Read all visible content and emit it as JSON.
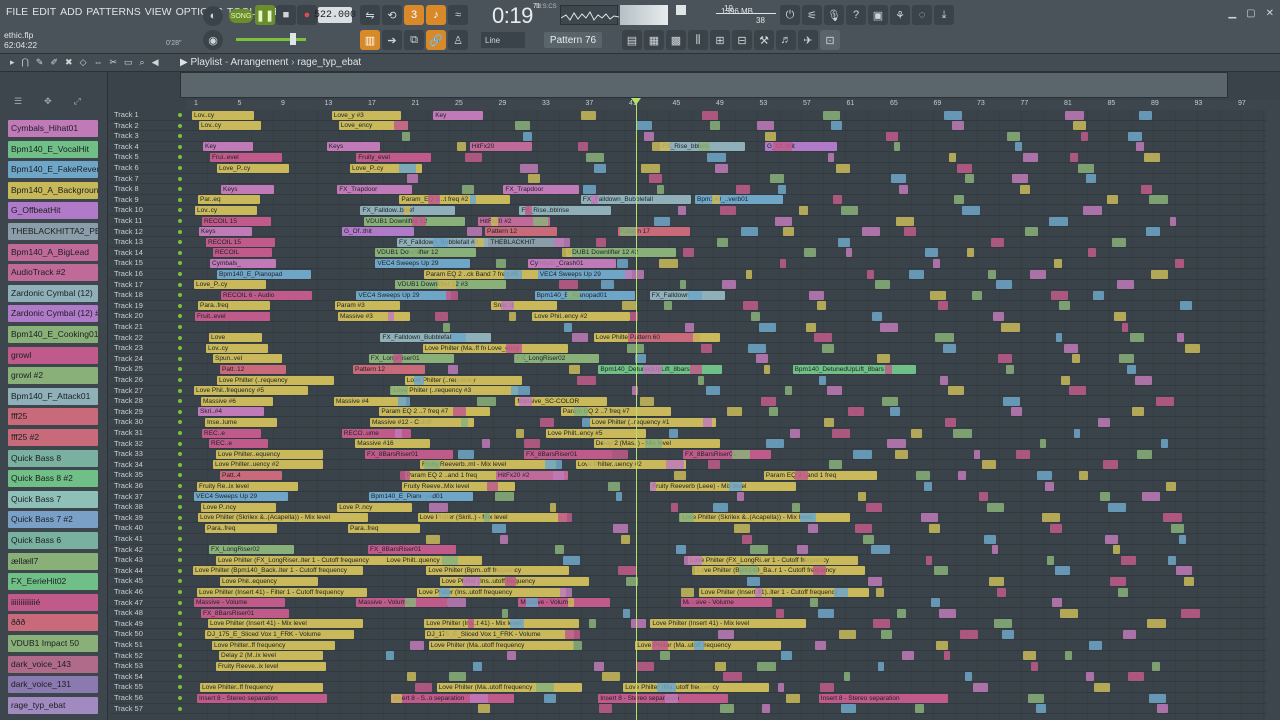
{
  "menu": [
    "FILE",
    "EDIT",
    "ADD",
    "PATTERNS",
    "VIEW",
    "OPTIONS",
    "TOOLS",
    "HELP"
  ],
  "song": {
    "file": "ethic.flp",
    "time": "62:04:22",
    "pos": "0'28\"",
    "mode": "SONG"
  },
  "tempo": "522.000",
  "clock": {
    "value": "0:19",
    "sub": "M:S:CS",
    "cs": "71"
  },
  "cpu": {
    "voices": "19",
    "mem": "1396 MB",
    "num": "38"
  },
  "pattern": "Pattern 76",
  "snap": "Line",
  "playlist": {
    "title": "Playlist",
    "sep": "-",
    "view": "Arrangement",
    "arrangement": "rage_typ_ebat"
  },
  "ruler": [
    "1",
    "5",
    "9",
    "13",
    "17",
    "21",
    "25",
    "29",
    "33",
    "37",
    "41",
    "45",
    "49",
    "53",
    "57",
    "61",
    "65",
    "69",
    "73",
    "77",
    "81",
    "85",
    "89",
    "93",
    "97"
  ],
  "channels": [
    {
      "label": "Cymbals_Hihat01",
      "color": "#c07ab8"
    },
    {
      "label": "Bpm140_E_VocalHit",
      "color": "#6fbf86"
    },
    {
      "label": "Bpm140_E_FakeReverb01",
      "color": "#6fa6c8"
    },
    {
      "label": "Bpm140_A_BackgroundA..",
      "color": "#c7b85a"
    },
    {
      "label": "G_OffbeatHit",
      "color": "#b07ac8"
    },
    {
      "label": "THEBLACKHITTA2_PERCUS..",
      "color": "#8a9da8"
    },
    {
      "label": "Bpm140_A_BigLead",
      "color": "#c06a9a"
    },
    {
      "label": "AudioTrack #2",
      "color": "#c06a9a"
    },
    {
      "label": "Zardonic Cymbal (12)",
      "color": "#8fb0b8"
    },
    {
      "label": "Zardonic Cymbal (12) #2",
      "color": "#b07ac8"
    },
    {
      "label": "Bpm140_E_Cooking01",
      "color": "#8ab07a"
    },
    {
      "label": "growl",
      "color": "#c05a8a"
    },
    {
      "label": "growl #2",
      "color": "#8ab07a"
    },
    {
      "label": "Bpm140_F_Attack01",
      "color": "#8fb0b8"
    },
    {
      "label": "fff25",
      "color": "#c86a7a"
    },
    {
      "label": "fff25 #2",
      "color": "#c86a7a"
    },
    {
      "label": "Quick Bass 8",
      "color": "#7ab0a0"
    },
    {
      "label": "Quick Bass 8 #2",
      "color": "#6fbf86"
    },
    {
      "label": "Quick Bass 7",
      "color": "#8fc0b8"
    },
    {
      "label": "Quick Bass 7 #2",
      "color": "#7aa0c8"
    },
    {
      "label": "Quick Bass 6",
      "color": "#7ab0a0"
    },
    {
      "label": "ællæll7",
      "color": "#8ab07a"
    },
    {
      "label": "FX_EerieHit02",
      "color": "#6fbf86"
    },
    {
      "label": "iiiiiiiiiiiiié",
      "color": "#c05a8a"
    },
    {
      "label": "ððð",
      "color": "#c86a7a"
    },
    {
      "label": "VDUB1 Impact 50",
      "color": "#8ab07a"
    },
    {
      "label": "dark_voice_143",
      "color": "#b06a8a"
    },
    {
      "label": "dark_voice_131",
      "color": "#8a7ab0"
    },
    {
      "label": "rage_typ_ebat",
      "color": "#a08ac0"
    }
  ],
  "tracks": [
    "Track 1",
    "Track 2",
    "Track 3",
    "Track 4",
    "Track 5",
    "Track 6",
    "Track 7",
    "Track 8",
    "Track 9",
    "Track 10",
    "Track 11",
    "Track 12",
    "Track 13",
    "Track 14",
    "Track 15",
    "Track 16",
    "Track 17",
    "Track 18",
    "Track 19",
    "Track 20",
    "Track 21",
    "Track 22",
    "Track 23",
    "Track 24",
    "Track 25",
    "Track 26",
    "Track 27",
    "Track 28",
    "Track 29",
    "Track 30",
    "Track 31",
    "Track 32",
    "Track 33",
    "Track 34",
    "Track 35",
    "Track 36",
    "Track 37",
    "Track 38",
    "Track 39",
    "Track 40",
    "Track 41",
    "Track 42",
    "Track 43",
    "Track 44",
    "Track 45",
    "Track 46",
    "Track 47",
    "Track 48",
    "Track 49",
    "Track 50",
    "Track 51",
    "Track 52",
    "Track 53",
    "Track 54",
    "Track 55",
    "Track 56",
    "Track 57"
  ],
  "clips": [
    {
      "row": 0,
      "label": "Lov..cy",
      "color": "#c9b95a"
    },
    {
      "row": 0,
      "label": "Love_y #3",
      "color": "#c9b95a"
    },
    {
      "row": 0,
      "label": "Key",
      "color": "#c07ab8"
    },
    {
      "row": 1,
      "label": "Lov..cy",
      "color": "#c9b95a"
    },
    {
      "row": 1,
      "label": "Love_ency",
      "color": "#c9b95a"
    },
    {
      "row": 3,
      "label": "Key",
      "color": "#c07ab8"
    },
    {
      "row": 3,
      "label": "Keys",
      "color": "#c07ab8"
    },
    {
      "row": 3,
      "label": "HitFx20",
      "color": "#c06a9a"
    },
    {
      "row": 3,
      "label": "FX_Rise_bblers",
      "color": "#8fb0b8"
    },
    {
      "row": 3,
      "label": "G_Of..thit",
      "color": "#b07ac8"
    },
    {
      "row": 4,
      "label": "Frui..evel",
      "color": "#c05a8a"
    },
    {
      "row": 4,
      "label": "Fruity_evel",
      "color": "#c05a8a"
    },
    {
      "row": 5,
      "label": "Love_P..cy",
      "color": "#c9b95a"
    },
    {
      "row": 5,
      "label": "Love_P..cy",
      "color": "#c9b95a"
    },
    {
      "row": 7,
      "label": "Keys",
      "color": "#c07ab8"
    },
    {
      "row": 7,
      "label": "FX_Trapdoor",
      "color": "#c07ab8"
    },
    {
      "row": 7,
      "label": "FX_Trapdoor",
      "color": "#c07ab8"
    },
    {
      "row": 8,
      "label": "Par..eq",
      "color": "#c9b95a"
    },
    {
      "row": 8,
      "label": "Param_EQ 2 ..t freq #2",
      "color": "#c9b95a"
    },
    {
      "row": 8,
      "label": "FX_Falldown_Bubblefall",
      "color": "#8fb0b8"
    },
    {
      "row": 8,
      "label": "Bpm140_..verb01",
      "color": "#6fa6c8"
    },
    {
      "row": 9,
      "label": "Lov..cy",
      "color": "#c9b95a"
    },
    {
      "row": 9,
      "label": "FX_Falldow..bblef",
      "color": "#8fb0b8"
    },
    {
      "row": 9,
      "label": "FX_Rise..bblrise",
      "color": "#8fb0b8"
    },
    {
      "row": 10,
      "label": "RECOIL 15",
      "color": "#c05a8a"
    },
    {
      "row": 10,
      "label": "VDUB1 Downlifter 12",
      "color": "#8ab07a"
    },
    {
      "row": 10,
      "label": "HitFx20 #2",
      "color": "#c06a9a"
    },
    {
      "row": 11,
      "label": "Keys",
      "color": "#c07ab8"
    },
    {
      "row": 11,
      "label": "G_Of..thit",
      "color": "#b07ac8"
    },
    {
      "row": 11,
      "label": "Pattern 12",
      "color": "#c86a7a"
    },
    {
      "row": 11,
      "label": "Pattern 17",
      "color": "#c86a7a"
    },
    {
      "row": 12,
      "label": "RECOIL 15",
      "color": "#c05a8a"
    },
    {
      "row": 12,
      "label": "FX_Falldown_Bubblefall #3",
      "color": "#8fb0b8"
    },
    {
      "row": 12,
      "label": "THEBLACKHIT",
      "color": "#8a9da8"
    },
    {
      "row": 13,
      "label": "RECOIL",
      "color": "#c05a8a"
    },
    {
      "row": 13,
      "label": "VDUB1 Downlifter 12",
      "color": "#8ab07a"
    },
    {
      "row": 13,
      "label": "VDUB1 Downlifter 12 #2",
      "color": "#8ab07a"
    },
    {
      "row": 14,
      "label": "Cymbals_",
      "color": "#c07ab8"
    },
    {
      "row": 14,
      "label": "VEC4 Sweeps Up 29",
      "color": "#6fa6c8"
    },
    {
      "row": 14,
      "label": "Cymbals_Crash01",
      "color": "#c07ab8"
    },
    {
      "row": 15,
      "label": "Bpm140_E_Pianopad",
      "color": "#6fa6c8"
    },
    {
      "row": 15,
      "label": "Param EQ 2 ..ck Band 7 freq #5",
      "color": "#c9b95a"
    },
    {
      "row": 15,
      "label": "VEC4 Sweeps Up 29",
      "color": "#6fa6c8"
    },
    {
      "row": 16,
      "label": "Love_P..cy",
      "color": "#c9b95a"
    },
    {
      "row": 16,
      "label": "VDUB1 Downlifter 12 #3",
      "color": "#8ab07a"
    },
    {
      "row": 17,
      "label": "RECOIL 6 - Audio",
      "color": "#c05a8a"
    },
    {
      "row": 17,
      "label": "VEC4 Sweeps Up 29",
      "color": "#6fa6c8"
    },
    {
      "row": 17,
      "label": "Bpm140_E_Pianopad01",
      "color": "#6fa6c8"
    },
    {
      "row": 17,
      "label": "FX_Falldown",
      "color": "#8fb0b8"
    },
    {
      "row": 18,
      "label": "Para..freq",
      "color": "#c9b95a"
    },
    {
      "row": 18,
      "label": "Param #3",
      "color": "#c9b95a"
    },
    {
      "row": 18,
      "label": "Snar..it",
      "color": "#c9b95a"
    },
    {
      "row": 19,
      "label": "Fruit..evel",
      "color": "#c05a8a"
    },
    {
      "row": 19,
      "label": "Massive #3",
      "color": "#c9b95a"
    },
    {
      "row": 19,
      "label": "Love Phil..ency #2",
      "color": "#c9b95a"
    },
    {
      "row": 21,
      "label": "Love",
      "color": "#c9b95a"
    },
    {
      "row": 21,
      "label": "FX_Falldown_Bubblefall",
      "color": "#8fb0b8"
    },
    {
      "row": 21,
      "label": "Love Philter (..requency #2",
      "color": "#c9b95a"
    },
    {
      "row": 21,
      "label": "Pattern 60",
      "color": "#c86a7a"
    },
    {
      "row": 22,
      "label": "Lov..cy",
      "color": "#c9b95a"
    },
    {
      "row": 22,
      "label": "Love Philter (Ma..ff frequency #4",
      "color": "#c9b95a"
    },
    {
      "row": 22,
      "label": "Love_ency",
      "color": "#c9b95a"
    },
    {
      "row": 23,
      "label": "Spun..vel",
      "color": "#c9b95a"
    },
    {
      "row": 23,
      "label": "FX_LongRiser01",
      "color": "#8ab07a"
    },
    {
      "row": 23,
      "label": "FX_LongRiser02",
      "color": "#8ab07a"
    },
    {
      "row": 24,
      "label": "Patt..12",
      "color": "#c86a7a"
    },
    {
      "row": 24,
      "label": "Pattern 12",
      "color": "#c86a7a"
    },
    {
      "row": 24,
      "label": "Bpm140_DetunedUpLift_8bars",
      "color": "#6fbf86"
    },
    {
      "row": 24,
      "label": "Bpm140_DetunedUpLift_8bars",
      "color": "#6fbf86"
    },
    {
      "row": 25,
      "label": "Love Philter (..requency",
      "color": "#c9b95a"
    },
    {
      "row": 25,
      "label": "Love Philter (..requency",
      "color": "#c9b95a"
    },
    {
      "row": 26,
      "label": "Love Phil..frequency #5",
      "color": "#c9b95a"
    },
    {
      "row": 26,
      "label": "Love Philter (..requency #3",
      "color": "#c9b95a"
    },
    {
      "row": 27,
      "label": "Massive #6",
      "color": "#c9b95a"
    },
    {
      "row": 27,
      "label": "Massive #4",
      "color": "#c9b95a"
    },
    {
      "row": 27,
      "label": "Massive_SC-COLOR",
      "color": "#c9b95a"
    },
    {
      "row": 28,
      "label": "Skri..#4",
      "color": "#c07ab8"
    },
    {
      "row": 28,
      "label": "Param EQ 2 ..7 freq #7",
      "color": "#c9b95a"
    },
    {
      "row": 28,
      "label": "Param EQ 2 ..7 freq #7",
      "color": "#c9b95a"
    },
    {
      "row": 29,
      "label": "Inse..lume",
      "color": "#c9b95a"
    },
    {
      "row": 29,
      "label": "Massive #12 - Cutoff",
      "color": "#c9b95a"
    },
    {
      "row": 29,
      "label": "Love Philter (..requency #1",
      "color": "#c9b95a"
    },
    {
      "row": 30,
      "label": "REC..e",
      "color": "#c05a8a"
    },
    {
      "row": 30,
      "label": "RECO..ume",
      "color": "#c05a8a"
    },
    {
      "row": 30,
      "label": "Love Philt..ency #5",
      "color": "#c9b95a"
    },
    {
      "row": 31,
      "label": "REC..e",
      "color": "#c05a8a"
    },
    {
      "row": 31,
      "label": "Massive #16",
      "color": "#c9b95a"
    },
    {
      "row": 31,
      "label": "Delay 2 (Mas..) - Mix level",
      "color": "#c9b95a"
    },
    {
      "row": 32,
      "label": "Love Philter..equency",
      "color": "#c9b95a"
    },
    {
      "row": 32,
      "label": "FX_8BarsRiser01",
      "color": "#c05a8a"
    },
    {
      "row": 32,
      "label": "FX_8BarsRiser01",
      "color": "#c05a8a"
    },
    {
      "row": 32,
      "label": "FX_8BarsRiser01",
      "color": "#c05a8a"
    },
    {
      "row": 33,
      "label": "Love Philter..uency #2",
      "color": "#c9b95a"
    },
    {
      "row": 33,
      "label": "Fruity Reeverb..ml - Mix level",
      "color": "#c9b95a"
    },
    {
      "row": 33,
      "label": "Love Philter..uency #2",
      "color": "#c9b95a"
    },
    {
      "row": 34,
      "label": "Patt..4",
      "color": "#c86a7a"
    },
    {
      "row": 34,
      "label": "Param EQ 2 ..and 1 freq",
      "color": "#c9b95a"
    },
    {
      "row": 34,
      "label": "HitFx20 #2",
      "color": "#c06a9a"
    },
    {
      "row": 34,
      "label": "Param EQ 2 ..and 1 freq",
      "color": "#c9b95a"
    },
    {
      "row": 35,
      "label": "Fruity Re..ix level",
      "color": "#c9b95a"
    },
    {
      "row": 35,
      "label": "Fruity Reeve..Mix level",
      "color": "#c9b95a"
    },
    {
      "row": 35,
      "label": "Fruity Reeverb (Leee) - Mix level",
      "color": "#c9b95a"
    },
    {
      "row": 36,
      "label": "VEC4 Sweeps Up 29",
      "color": "#6fa6c8"
    },
    {
      "row": 36,
      "label": "Bpm140_E_Piano pad01",
      "color": "#6fa6c8"
    },
    {
      "row": 37,
      "label": "Love P..ncy",
      "color": "#c9b95a"
    },
    {
      "row": 37,
      "label": "Love P..ncy",
      "color": "#c9b95a"
    },
    {
      "row": 38,
      "label": "Love Philter (Skrilex &..(Acapella)) - Mix level",
      "color": "#c9b95a"
    },
    {
      "row": 38,
      "label": "Love Philter (Skril..) - Mix level",
      "color": "#c9b95a"
    },
    {
      "row": 38,
      "label": "Love Philter (Skrilex &..(Acapella)) - Mix level",
      "color": "#c9b95a"
    },
    {
      "row": 39,
      "label": "Para..freq",
      "color": "#c9b95a"
    },
    {
      "row": 39,
      "label": "Para..freq",
      "color": "#c9b95a"
    },
    {
      "row": 41,
      "label": "FX_LongRiser02",
      "color": "#8ab07a"
    },
    {
      "row": 41,
      "label": "FX_8BarsRiser01",
      "color": "#c05a8a"
    },
    {
      "row": 42,
      "label": "Love Philter (FX_LongRiser..lter 1 - Cutoff frequency",
      "color": "#c9b95a"
    },
    {
      "row": 42,
      "label": "Love Philt..quency",
      "color": "#c9b95a"
    },
    {
      "row": 42,
      "label": "Love Philter (FX_LongRi..er 1 - Cutoff frequency",
      "color": "#c9b95a"
    },
    {
      "row": 43,
      "label": "Love Philter (Bpm140_Back..lter 1 - Cutoff frequency",
      "color": "#c9b95a"
    },
    {
      "row": 43,
      "label": "Love Philter (Bpm..off frequency",
      "color": "#c9b95a"
    },
    {
      "row": 43,
      "label": "Love Philter (Bpm140_Ba..r 1 - Cutoff frequency",
      "color": "#c9b95a"
    },
    {
      "row": 44,
      "label": "Love Phil..equency",
      "color": "#c9b95a"
    },
    {
      "row": 44,
      "label": "Love Philter (Ins..utoff frequency",
      "color": "#c9b95a"
    },
    {
      "row": 45,
      "label": "Love Philter (Insert 41) - Filter 1 - Cutoff frequency",
      "color": "#c9b95a"
    },
    {
      "row": 45,
      "label": "Love Philter (Ins..utoff frequency",
      "color": "#c9b95a"
    },
    {
      "row": 45,
      "label": "Love Philter (Insert 41)..lter 1 - Cutoff frequency",
      "color": "#c9b95a"
    },
    {
      "row": 46,
      "label": "Massive - Volume",
      "color": "#c05a8a"
    },
    {
      "row": 46,
      "label": "Massive - Volume",
      "color": "#c05a8a"
    },
    {
      "row": 46,
      "label": "Massive - Volume",
      "color": "#c05a8a"
    },
    {
      "row": 46,
      "label": "Massive - Volume",
      "color": "#c05a8a"
    },
    {
      "row": 47,
      "label": "FX_8BarsRiser01",
      "color": "#c05a8a"
    },
    {
      "row": 48,
      "label": "Love Philter (Insert 41) - Mix level",
      "color": "#c9b95a"
    },
    {
      "row": 48,
      "label": "Love Philter (Ins..t 41) - Mix level",
      "color": "#c9b95a"
    },
    {
      "row": 48,
      "label": "Love Philter (Insert 41) - Mix level",
      "color": "#c9b95a"
    },
    {
      "row": 49,
      "label": "DJ_175_E_Sliced Vox 1_FRK - Volume",
      "color": "#c9b95a"
    },
    {
      "row": 49,
      "label": "DJ_175_E_Sliced Vox 1_FRK - Volume",
      "color": "#c9b95a"
    },
    {
      "row": 50,
      "label": "Love Philter..ff frequency",
      "color": "#c9b95a"
    },
    {
      "row": 50,
      "label": "Love Philter (Ma..utoff frequency",
      "color": "#c9b95a"
    },
    {
      "row": 50,
      "label": "Love Philter (Ma..utoff frequency",
      "color": "#c9b95a"
    },
    {
      "row": 51,
      "label": "Delay 2 (M..ix level",
      "color": "#c9b95a"
    },
    {
      "row": 52,
      "label": "Fruity Reeve..ix level",
      "color": "#c9b95a"
    },
    {
      "row": 54,
      "label": "Love Philter..ff frequency",
      "color": "#c9b95a"
    },
    {
      "row": 54,
      "label": "Love Philter (Ma..utoff frequency",
      "color": "#c9b95a"
    },
    {
      "row": 54,
      "label": "Love Philter (Ma..utoff frequency",
      "color": "#c9b95a"
    },
    {
      "row": 55,
      "label": "Insert 8 - Stereo separation",
      "color": "#c05a8a"
    },
    {
      "row": 55,
      "label": "Insert 8 - S..o separation",
      "color": "#c05a8a"
    },
    {
      "row": 55,
      "label": "Insert 8 - Stereo separation",
      "color": "#c05a8a"
    },
    {
      "row": 55,
      "label": "Insert 8 - Stereo separation",
      "color": "#c05a8a"
    }
  ]
}
